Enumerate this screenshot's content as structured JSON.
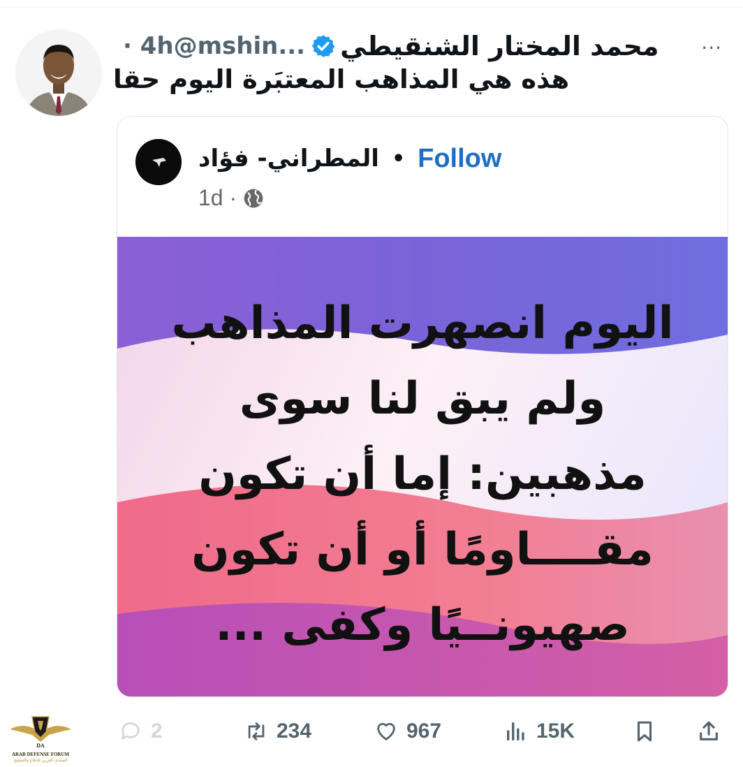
{
  "tweet": {
    "display_name": "محمد المختار الشنقيطي",
    "handle": "@mshin...",
    "time": "· 4h",
    "more_label": "···",
    "text": "هذه هي المذاهب المعتبَرة اليوم حقا"
  },
  "quoted_post": {
    "author_name": "المطراني- فؤاد",
    "follow_label": "Follow",
    "separator": "•",
    "age": "1d ·",
    "image_text_lines": [
      "اليوم انصهرت المذاهب",
      "ولم يبق لنا سوى",
      "مذهبين: إما أن تكون",
      "مقــــاومًا  أو أن تكون",
      "صهيونــيًا وكفى ..."
    ]
  },
  "actions": {
    "replies": "2",
    "retweets": "234",
    "likes": "967",
    "views": "15K"
  },
  "watermark": {
    "logo_text": "ARAB DEFENSE FORUM",
    "logo_subtext": "المنتدى العربي للدفاع والتسليح"
  },
  "colors": {
    "verified_blue": "#1d9bf0",
    "follow_blue": "#1d6fc6",
    "icon_gray": "#536471"
  }
}
